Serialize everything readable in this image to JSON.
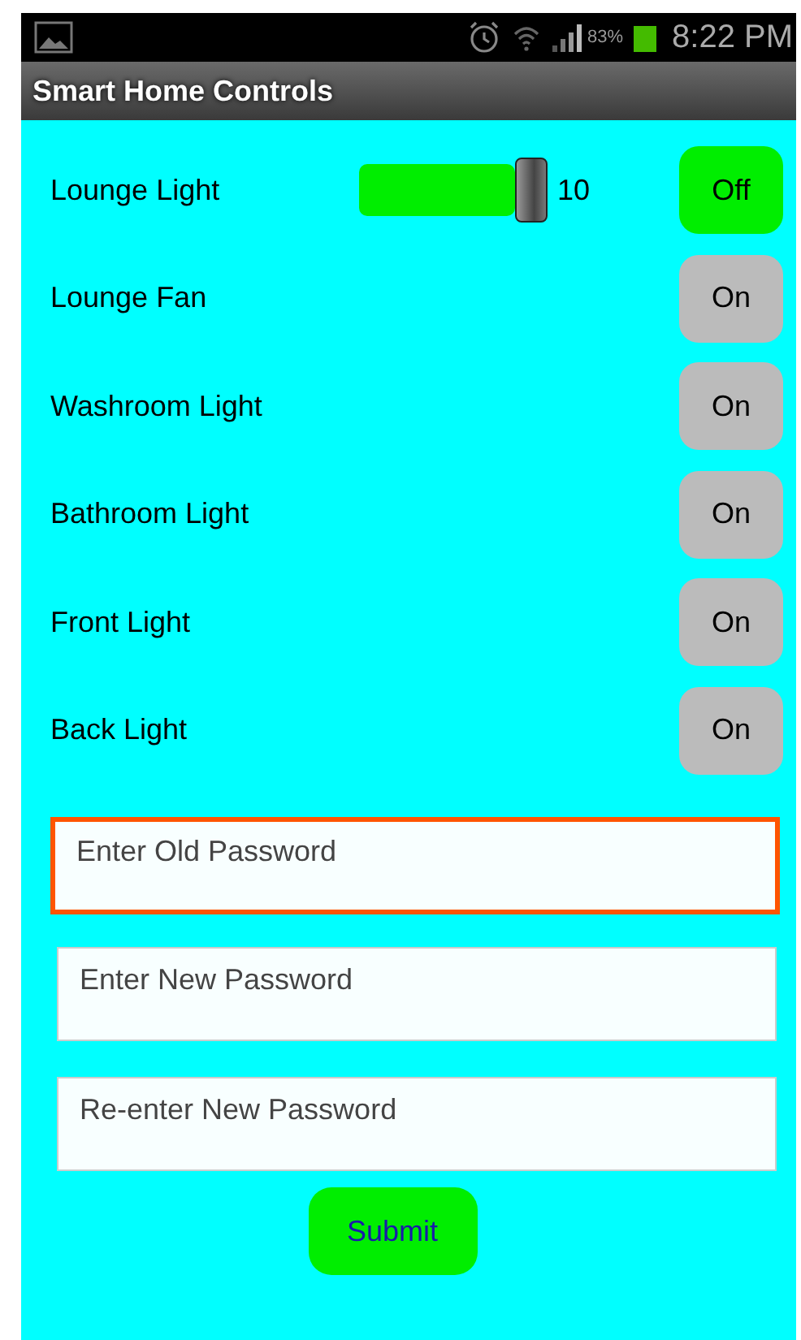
{
  "status_bar": {
    "battery": "83%",
    "time": "8:22 PM"
  },
  "window": {
    "title": "Smart Home Controls"
  },
  "devices": [
    {
      "kind": "slider",
      "name": "Lounge Light",
      "level": 1,
      "reading": "10",
      "on": true,
      "button": "Off"
    },
    {
      "kind": "plain",
      "name": "Lounge Fan",
      "on": false,
      "button": "On"
    },
    {
      "kind": "plain",
      "name": "Washroom Light",
      "on": false,
      "button": "On"
    },
    {
      "kind": "plain",
      "name": "Bathroom Light",
      "on": false,
      "button": "On"
    },
    {
      "kind": "plain",
      "name": "Front Light",
      "on": false,
      "button": "On"
    },
    {
      "kind": "plain",
      "name": "Back Light",
      "on": false,
      "button": "On"
    }
  ],
  "fields": [
    {
      "placeholder": "Enter Old Password",
      "focused": true
    },
    {
      "placeholder": "Enter New Password",
      "focused": false
    },
    {
      "placeholder": "Re-enter New Password",
      "focused": false
    }
  ],
  "submit": "Submit"
}
